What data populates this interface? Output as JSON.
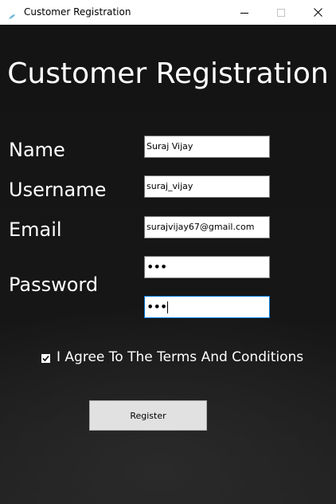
{
  "window": {
    "title": "Customer Registration"
  },
  "form": {
    "heading": "Customer Registration",
    "name_label": "Name",
    "name_value": "Suraj Vijay",
    "username_label": "Username",
    "username_value": "suraj_vijay",
    "email_label": "Email",
    "email_value": "surajvijay67@gmail.com",
    "password_label": "Password",
    "password_mask": "•••",
    "confirm_password_mask": "•••",
    "agree_label": "I Agree To The Terms And Conditions",
    "agree_checked": true,
    "register_label": "Register"
  },
  "colors": {
    "background": "#151515",
    "text": "#ffffff",
    "focus_border": "#0078d7",
    "button": "#e1e1e1"
  },
  "icons": {
    "app": "feather-icon",
    "minimize": "minimize-icon",
    "maximize": "maximize-icon",
    "close": "close-icon",
    "checkbox": "checkmark-icon"
  }
}
